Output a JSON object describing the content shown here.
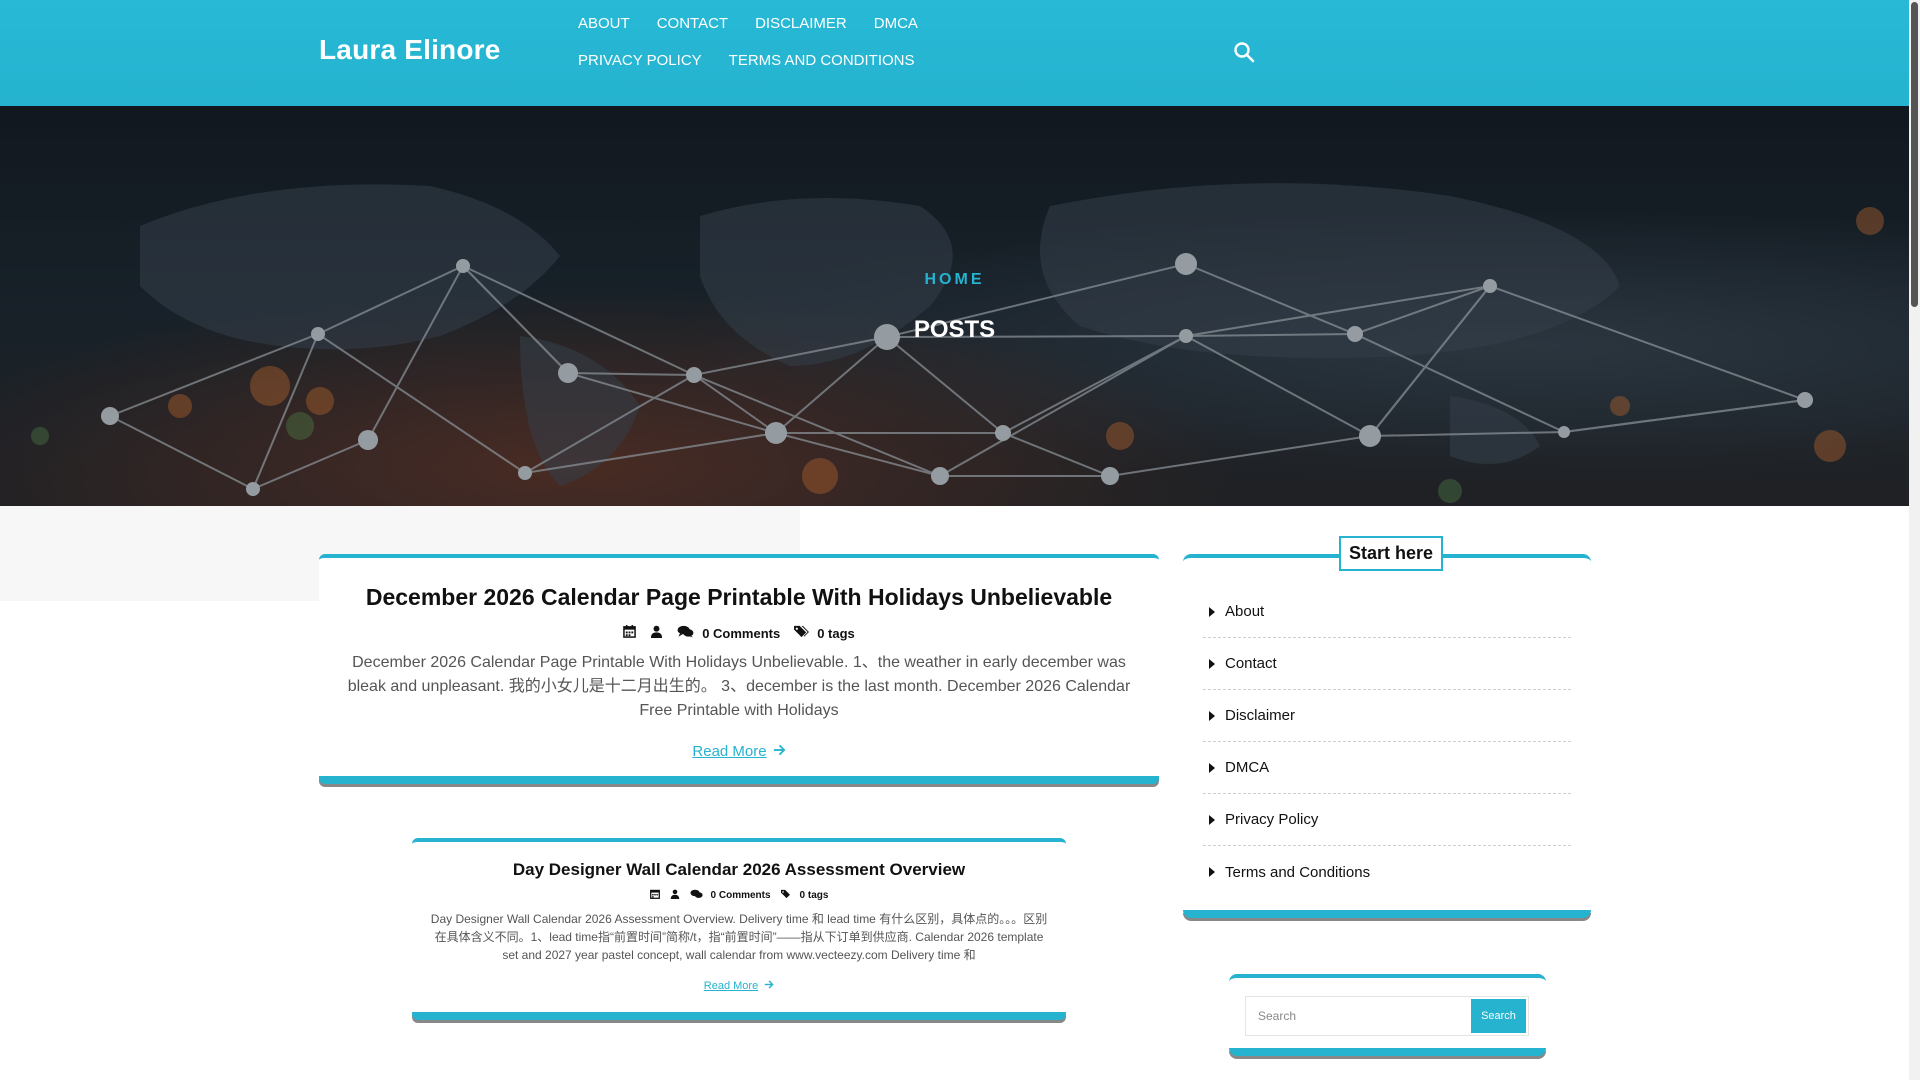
{
  "site": {
    "title": "Laura Elinore"
  },
  "nav": {
    "items": [
      {
        "label": "ABOUT"
      },
      {
        "label": "CONTACT"
      },
      {
        "label": "DISCLAIMER"
      },
      {
        "label": "DMCA"
      },
      {
        "label": "PRIVACY POLICY"
      },
      {
        "label": "TERMS AND CONDITIONS"
      }
    ],
    "search_icon": "search-icon"
  },
  "hero": {
    "breadcrumb": "HOME",
    "heading": "POSTS"
  },
  "posts": [
    {
      "title": "December 2026 Calendar Page Printable With Holidays Unbelievable",
      "comments": "0 Comments",
      "tags": "0 tags",
      "excerpt": "December 2026 Calendar Page Printable With Holidays Unbelievable. 1、the weather in early december was bleak and unpleasant. 我的小女儿是十二月出生的。 3、december is the last month. December 2026 Calendar Free Printable with Holidays",
      "read_more": "Read More"
    },
    {
      "title": "Day Designer Wall Calendar 2026 Assessment Overview",
      "comments": "0 Comments",
      "tags": "0 tags",
      "excerpt": "Day Designer Wall Calendar 2026 Assessment Overview. Delivery time 和 lead time 有什么区别，具体点的。。。区别在具体含义不同。1、lead time指“前置时间”简称/t，指“前置时间”——指从下订单到供应商. Calendar 2026 template set and 2027 year pastel concept, wall calendar from www.vecteezy.com Delivery time 和",
      "read_more": "Read More"
    }
  ],
  "sidebar": {
    "start_here": {
      "title": "Start here",
      "items": [
        {
          "label": "About"
        },
        {
          "label": "Contact"
        },
        {
          "label": "Disclaimer"
        },
        {
          "label": "DMCA"
        },
        {
          "label": "Privacy Policy"
        },
        {
          "label": "Terms and Conditions"
        }
      ]
    },
    "search": {
      "placeholder": "Search",
      "button_label": "Search"
    }
  },
  "colors": {
    "accent": "#25b3cf",
    "header_bg": "#27b9d6"
  }
}
